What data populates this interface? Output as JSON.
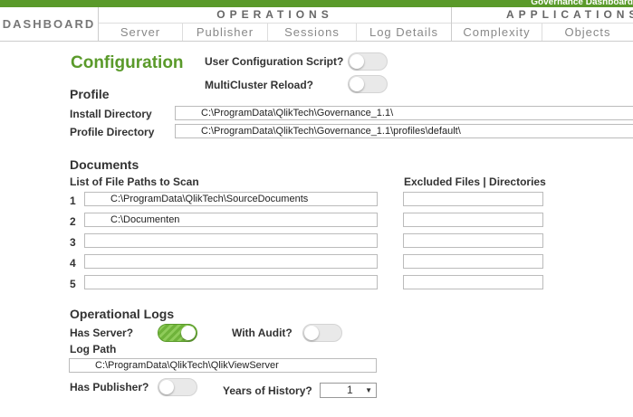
{
  "header": {
    "title": "Governance Dashboard"
  },
  "nav": {
    "dashboard": "DASHBOARD",
    "operations": {
      "label": "OPERATIONS",
      "tabs": [
        "Server",
        "Publisher",
        "Sessions",
        "Log Details"
      ]
    },
    "applications": {
      "label": "APPLICATIONS",
      "tabs": [
        "Complexity",
        "Objects"
      ]
    }
  },
  "config": {
    "title": "Configuration",
    "user_script_label": "User Configuration Script?",
    "user_script_on": false,
    "multicluster_label": "MultiCluster Reload?",
    "multicluster_on": false
  },
  "profile": {
    "title": "Profile",
    "install_label": "Install Directory",
    "install_value": "C:\\ProgramData\\QlikTech\\Governance_1.1\\",
    "profile_label": "Profile Directory",
    "profile_value": "C:\\ProgramData\\QlikTech\\Governance_1.1\\profiles\\default\\"
  },
  "documents": {
    "title": "Documents",
    "paths_header": "List of File Paths to Scan",
    "excluded_header": "Excluded Files | Directories",
    "rows": [
      {
        "num": "1",
        "path": "C:\\ProgramData\\QlikTech\\SourceDocuments",
        "excluded": ""
      },
      {
        "num": "2",
        "path": "C:\\Documenten",
        "excluded": ""
      },
      {
        "num": "3",
        "path": "",
        "excluded": ""
      },
      {
        "num": "4",
        "path": "",
        "excluded": ""
      },
      {
        "num": "5",
        "path": "",
        "excluded": ""
      }
    ]
  },
  "logs": {
    "title": "Operational Logs",
    "has_server_label": "Has Server?",
    "has_server_on": true,
    "with_audit_label": "With Audit?",
    "with_audit_on": false,
    "log_path_label": "Log Path",
    "log_path_value": "C:\\ProgramData\\QlikTech\\QlikViewServer",
    "has_publisher_label": "Has Publisher?",
    "has_publisher_on": false,
    "years_label": "Years of History?",
    "years_value": "1"
  },
  "colors": {
    "accent": "#5a9a2a",
    "toggle_off": "#e9e9e9"
  }
}
